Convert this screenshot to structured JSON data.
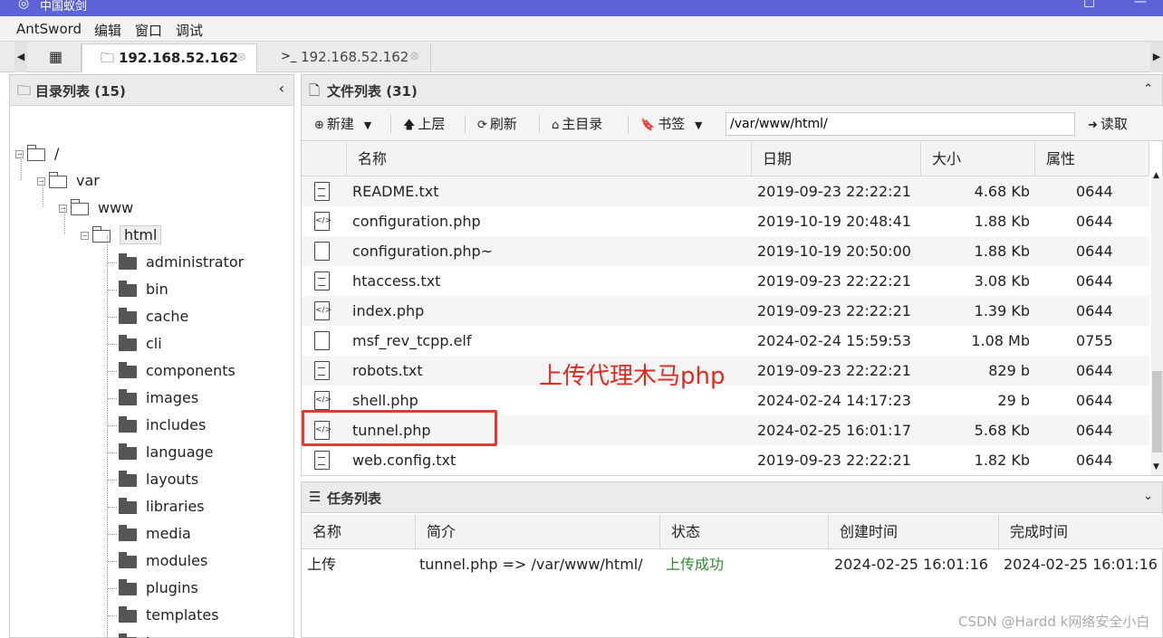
{
  "window": {
    "title": "中国蚁剑",
    "minimize": "□",
    "close": "—"
  },
  "menu": [
    "AntSword",
    "编辑",
    "窗口",
    "调试"
  ],
  "tabs": [
    {
      "icon": "folder-icon",
      "label": "192.168.52.162",
      "active": true
    },
    {
      "icon": "terminal-icon",
      "label": "192.168.52.162",
      "active": false
    }
  ],
  "dir_panel": {
    "title": "目录列表 (15)",
    "tree_root": "/",
    "tree_path": [
      "var",
      "www",
      "html"
    ],
    "children": [
      "administrator",
      "bin",
      "cache",
      "cli",
      "components",
      "images",
      "includes",
      "language",
      "layouts",
      "libraries",
      "media",
      "modules",
      "plugins",
      "templates",
      "tmp"
    ]
  },
  "file_panel": {
    "title": "文件列表 (31)",
    "toolbar": {
      "new": "新建",
      "up": "上层",
      "refresh": "刷新",
      "home": "主目录",
      "bookmark": "书签",
      "path": "/var/www/html/",
      "read": "读取"
    },
    "columns": [
      "名称",
      "日期",
      "大小",
      "属性"
    ],
    "rows": [
      {
        "name": "README.txt",
        "date": "2019-09-23 22:22:21",
        "size": "4.68 Kb",
        "attr": "0644",
        "icon": "text-file-icon"
      },
      {
        "name": "configuration.php",
        "date": "2019-10-19 20:48:41",
        "size": "1.88 Kb",
        "attr": "0644",
        "icon": "code-file-icon"
      },
      {
        "name": "configuration.php~",
        "date": "2019-10-19 20:50:00",
        "size": "1.88 Kb",
        "attr": "0644",
        "icon": "file-icon"
      },
      {
        "name": "htaccess.txt",
        "date": "2019-09-23 22:22:21",
        "size": "3.08 Kb",
        "attr": "0644",
        "icon": "text-file-icon"
      },
      {
        "name": "index.php",
        "date": "2019-09-23 22:22:21",
        "size": "1.39 Kb",
        "attr": "0644",
        "icon": "code-file-icon"
      },
      {
        "name": "msf_rev_tcpp.elf",
        "date": "2024-02-24 15:59:53",
        "size": "1.08 Mb",
        "attr": "0755",
        "icon": "file-icon"
      },
      {
        "name": "robots.txt",
        "date": "2019-09-23 22:22:21",
        "size": "829 b",
        "attr": "0644",
        "icon": "text-file-icon"
      },
      {
        "name": "shell.php",
        "date": "2024-02-24 14:17:23",
        "size": "29 b",
        "attr": "0644",
        "icon": "code-file-icon"
      },
      {
        "name": "tunnel.php",
        "date": "2024-02-25 16:01:17",
        "size": "5.68 Kb",
        "attr": "0644",
        "icon": "code-file-icon"
      },
      {
        "name": "web.config.txt",
        "date": "2019-09-23 22:22:21",
        "size": "1.82 Kb",
        "attr": "0644",
        "icon": "text-file-icon"
      }
    ],
    "annotation": "上传代理木马php",
    "annotation_color": "#e02a20"
  },
  "task_panel": {
    "title": "任务列表",
    "columns": [
      "名称",
      "简介",
      "状态",
      "创建时间",
      "完成时间"
    ],
    "rows": [
      {
        "name": "上传",
        "desc": "tunnel.php => /var/www/html/",
        "status": "上传成功",
        "created": "2024-02-25 16:01:16",
        "finished": "2024-02-25 16:01:16"
      }
    ],
    "status_color": "#2e8b2e"
  },
  "watermark": "CSDN @Hardd k网络安全小白"
}
